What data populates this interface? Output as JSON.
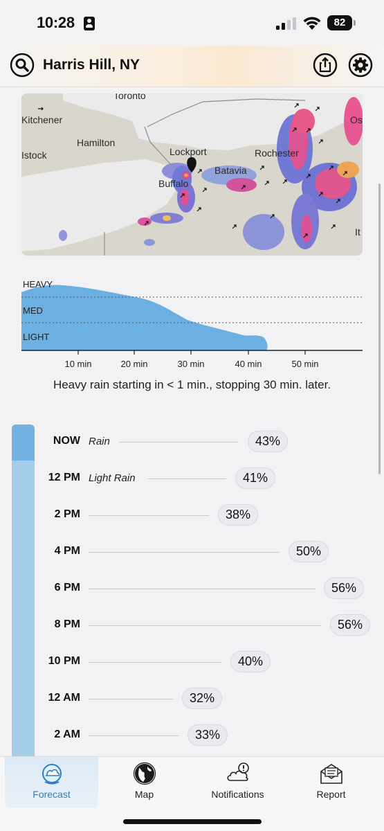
{
  "status_bar": {
    "time": "10:28",
    "battery": "82"
  },
  "header": {
    "location": "Harris Hill, NY"
  },
  "map": {
    "labels": [
      "Toronto",
      "Kitchener",
      "Hamilton",
      "Lockport",
      "Rochester",
      "Batavia",
      "Buffalo",
      "Os",
      "Istock",
      "It"
    ]
  },
  "precip_chart": {
    "levels": [
      "HEAVY",
      "MED",
      "LIGHT"
    ],
    "x_ticks": [
      "10 min",
      "20 min",
      "30 min",
      "40 min",
      "50 min"
    ],
    "summary": "Heavy rain starting in < 1 min., stopping 30 min. later."
  },
  "hourly": [
    {
      "time": "NOW",
      "condition": "Rain",
      "percent": "43%"
    },
    {
      "time": "12 PM",
      "condition": "Light Rain",
      "percent": "41%"
    },
    {
      "time": "2 PM",
      "condition": "",
      "percent": "38%"
    },
    {
      "time": "4 PM",
      "condition": "",
      "percent": "50%"
    },
    {
      "time": "6 PM",
      "condition": "",
      "percent": "56%"
    },
    {
      "time": "8 PM",
      "condition": "",
      "percent": "56%"
    },
    {
      "time": "10 PM",
      "condition": "",
      "percent": "40%"
    },
    {
      "time": "12 AM",
      "condition": "",
      "percent": "32%"
    },
    {
      "time": "2 AM",
      "condition": "",
      "percent": "33%"
    }
  ],
  "tabs": [
    {
      "label": "Forecast",
      "icon": "forecast-icon",
      "selected": true
    },
    {
      "label": "Map",
      "icon": "globe-icon",
      "selected": false
    },
    {
      "label": "Notifications",
      "icon": "cloud-alert-icon",
      "selected": false
    },
    {
      "label": "Report",
      "icon": "envelope-icon",
      "selected": false
    }
  ],
  "colors": {
    "accent": "#2d7fc1",
    "precip_fill": "#6cb0e2",
    "hour_bar": "#a4cdeb",
    "hour_bar_now": "#72b3e3"
  }
}
